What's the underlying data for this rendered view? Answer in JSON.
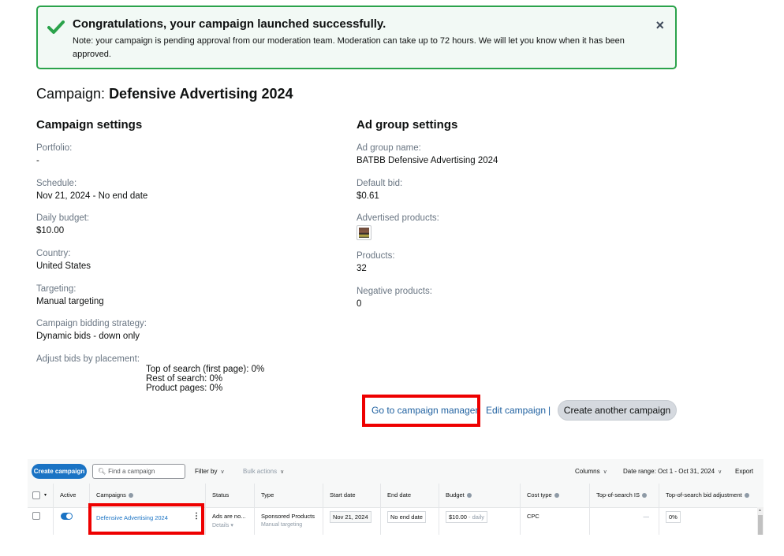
{
  "banner": {
    "title": "Congratulations, your campaign launched successfully.",
    "note": "Note: your campaign is pending approval from our moderation team. Moderation can take up to 72 hours. We will let you know when it has been approved.",
    "close_icon": "×",
    "accent_color": "#2ba34b"
  },
  "page": {
    "title_prefix": "Campaign: ",
    "title_name": "Defensive Advertising 2024"
  },
  "campaign_settings": {
    "heading": "Campaign settings",
    "fields": [
      {
        "label": "Portfolio:",
        "value": "-"
      },
      {
        "label": "Schedule:",
        "value": "Nov 21, 2024 - No end date"
      },
      {
        "label": "Daily budget:",
        "value": "$10.00"
      },
      {
        "label": "Country:",
        "value": "United States"
      },
      {
        "label": "Targeting:",
        "value": "Manual targeting"
      },
      {
        "label": "Campaign bidding strategy:",
        "value": "Dynamic bids - down only"
      }
    ],
    "placement": {
      "label": "Adjust bids by placement:",
      "lines": [
        "Top of search (first page): 0%",
        "Rest of search: 0%",
        "Product pages: 0%"
      ]
    }
  },
  "ad_group_settings": {
    "heading": "Ad group settings",
    "fields": [
      {
        "label": "Ad group name:",
        "value": "BATBB Defensive Advertising 2024"
      },
      {
        "label": "Default bid:",
        "value": "$0.61"
      },
      {
        "label": "Advertised products:",
        "value": ""
      },
      {
        "label": "Products:",
        "value": "32"
      },
      {
        "label": "Negative products:",
        "value": "0"
      }
    ]
  },
  "actions": {
    "go_to_manager": "Go to campaign manager",
    "edit_campaign": "Edit campaign",
    "separator": "|",
    "create_another": "Create another campaign",
    "link_color": "#2162a1",
    "highlight_color": "#ee0000"
  },
  "manager": {
    "toolbar": {
      "create_campaign": "Create campaign",
      "search_placeholder": "Find a campaign",
      "filter_by": "Filter by",
      "bulk_actions": "Bulk actions",
      "columns": "Columns",
      "date_range": "Date range: Oct 1 - Oct 31, 2024",
      "export": "Export"
    },
    "columns": [
      "Active",
      "Campaigns",
      "Status",
      "Type",
      "Start date",
      "End date",
      "Budget",
      "Cost type",
      "Top-of-search IS",
      "Top-of-search bid adjustment"
    ],
    "rows": [
      {
        "active": true,
        "campaign": "Defensive Advertising 2024",
        "status": "Ads are no...",
        "status_details": "Details",
        "type": "Sponsored Products",
        "type_sub": "Manual targeting",
        "start_date": "Nov 21, 2024",
        "end_date": "No end date",
        "budget": "$10.00",
        "budget_suffix": " - daily",
        "cost_type": "CPC",
        "top_of_search_is": "—",
        "top_of_search_bid_adj": "0%"
      }
    ]
  }
}
